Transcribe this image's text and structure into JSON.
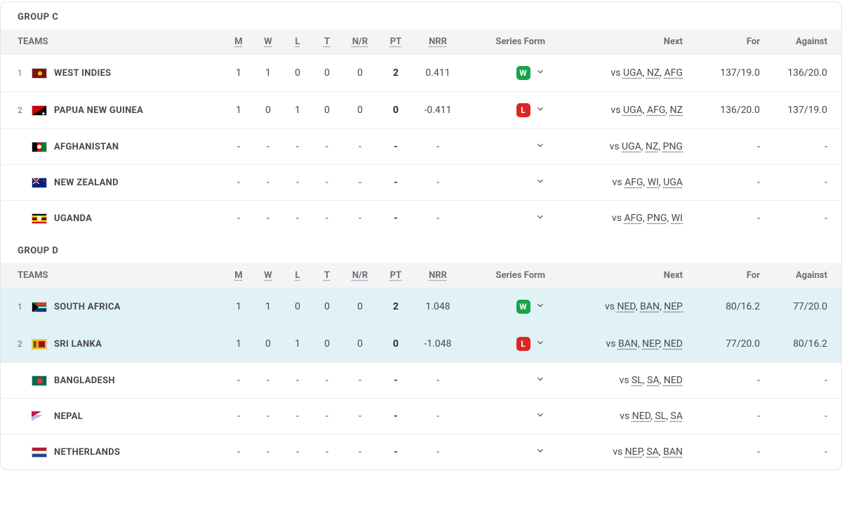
{
  "headers": {
    "teams": "TEAMS",
    "m": "M",
    "w": "W",
    "l": "L",
    "t": "T",
    "nr": "N/R",
    "pt": "PT",
    "nrr": "NRR",
    "form": "Series Form",
    "next": "Next",
    "for": "For",
    "against": "Against"
  },
  "groups": [
    {
      "title": "GROUP C",
      "rows": [
        {
          "rank": "1",
          "flag": "fl-wi",
          "name": "WEST INDIES",
          "m": "1",
          "w": "1",
          "l": "0",
          "t": "0",
          "nr": "0",
          "pt": "2",
          "nrr": "0.411",
          "form": "W",
          "next_p": "vs ",
          "next": [
            "UGA",
            "NZ",
            "AFG"
          ],
          "for": "137/19.0",
          "against": "136/20.0",
          "hl": false
        },
        {
          "rank": "2",
          "flag": "fl-png",
          "name": "PAPUA NEW GUINEA",
          "m": "1",
          "w": "0",
          "l": "1",
          "t": "0",
          "nr": "0",
          "pt": "0",
          "nrr": "-0.411",
          "form": "L",
          "next_p": "vs ",
          "next": [
            "UGA",
            "AFG",
            "NZ"
          ],
          "for": "136/20.0",
          "against": "137/19.0",
          "hl": false
        },
        {
          "rank": "",
          "flag": "fl-afg",
          "name": "AFGHANISTAN",
          "m": "-",
          "w": "-",
          "l": "-",
          "t": "-",
          "nr": "-",
          "pt": "-",
          "nrr": "-",
          "form": "",
          "next_p": "vs ",
          "next": [
            "UGA",
            "NZ",
            "PNG"
          ],
          "for": "-",
          "against": "-",
          "hl": false
        },
        {
          "rank": "",
          "flag": "fl-nz",
          "name": "NEW ZEALAND",
          "m": "-",
          "w": "-",
          "l": "-",
          "t": "-",
          "nr": "-",
          "pt": "-",
          "nrr": "-",
          "form": "",
          "next_p": "vs ",
          "next": [
            "AFG",
            "WI",
            "UGA"
          ],
          "for": "-",
          "against": "-",
          "hl": false
        },
        {
          "rank": "",
          "flag": "fl-uga",
          "name": "UGANDA",
          "m": "-",
          "w": "-",
          "l": "-",
          "t": "-",
          "nr": "-",
          "pt": "-",
          "nrr": "-",
          "form": "",
          "next_p": "vs ",
          "next": [
            "AFG",
            "PNG",
            "WI"
          ],
          "for": "-",
          "against": "-",
          "hl": false
        }
      ]
    },
    {
      "title": "GROUP D",
      "rows": [
        {
          "rank": "1",
          "flag": "fl-sa",
          "name": "SOUTH AFRICA",
          "m": "1",
          "w": "1",
          "l": "0",
          "t": "0",
          "nr": "0",
          "pt": "2",
          "nrr": "1.048",
          "form": "W",
          "next_p": "vs ",
          "next": [
            "NED",
            "BAN",
            "NEP"
          ],
          "for": "80/16.2",
          "against": "77/20.0",
          "hl": true
        },
        {
          "rank": "2",
          "flag": "fl-sl",
          "name": "SRI LANKA",
          "m": "1",
          "w": "0",
          "l": "1",
          "t": "0",
          "nr": "0",
          "pt": "0",
          "nrr": "-1.048",
          "form": "L",
          "next_p": "vs ",
          "next": [
            "BAN",
            "NEP",
            "NED"
          ],
          "for": "77/20.0",
          "against": "80/16.2",
          "hl": true
        },
        {
          "rank": "",
          "flag": "fl-ban",
          "name": "BANGLADESH",
          "m": "-",
          "w": "-",
          "l": "-",
          "t": "-",
          "nr": "-",
          "pt": "-",
          "nrr": "-",
          "form": "",
          "next_p": "vs ",
          "next": [
            "SL",
            "SA",
            "NED"
          ],
          "for": "-",
          "against": "-",
          "hl": false
        },
        {
          "rank": "",
          "flag": "fl-nep",
          "name": "NEPAL",
          "m": "-",
          "w": "-",
          "l": "-",
          "t": "-",
          "nr": "-",
          "pt": "-",
          "nrr": "-",
          "form": "",
          "next_p": "vs ",
          "next": [
            "NED",
            "SL",
            "SA"
          ],
          "for": "-",
          "against": "-",
          "hl": false
        },
        {
          "rank": "",
          "flag": "fl-ned",
          "name": "NETHERLANDS",
          "m": "-",
          "w": "-",
          "l": "-",
          "t": "-",
          "nr": "-",
          "pt": "-",
          "nrr": "-",
          "form": "",
          "next_p": "vs ",
          "next": [
            "NEP",
            "SA",
            "BAN"
          ],
          "for": "-",
          "against": "-",
          "hl": false
        }
      ]
    }
  ]
}
